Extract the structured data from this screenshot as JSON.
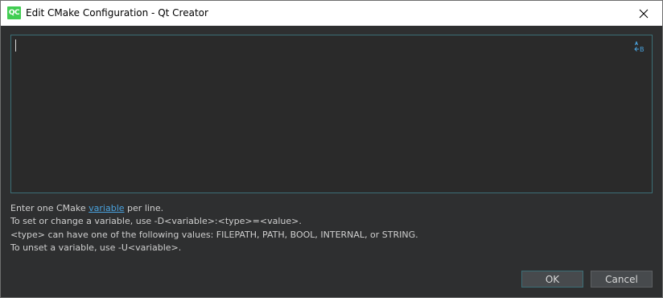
{
  "window": {
    "title": "Edit CMake Configuration - Qt Creator",
    "app_icon_text": "QC"
  },
  "editor": {
    "value": ""
  },
  "help": {
    "line1_prefix": "Enter one CMake ",
    "line1_link": "variable",
    "line1_suffix": " per line.",
    "line2": "To set or change a variable, use -D<variable>:<type>=<value>.",
    "line3": "<type> can have one of the following values: FILEPATH, PATH, BOOL, INTERNAL, or STRING.",
    "line4": "To unset a variable, use -U<variable>."
  },
  "buttons": {
    "ok": "OK",
    "cancel": "Cancel"
  },
  "colors": {
    "background": "#2e2f30",
    "accent": "#3c6e76",
    "link": "#4aa3df",
    "app_icon": "#41cd52"
  },
  "icons": {
    "app": "qt-creator-icon",
    "close": "close-icon",
    "editor_tool": "text-case-icon"
  }
}
